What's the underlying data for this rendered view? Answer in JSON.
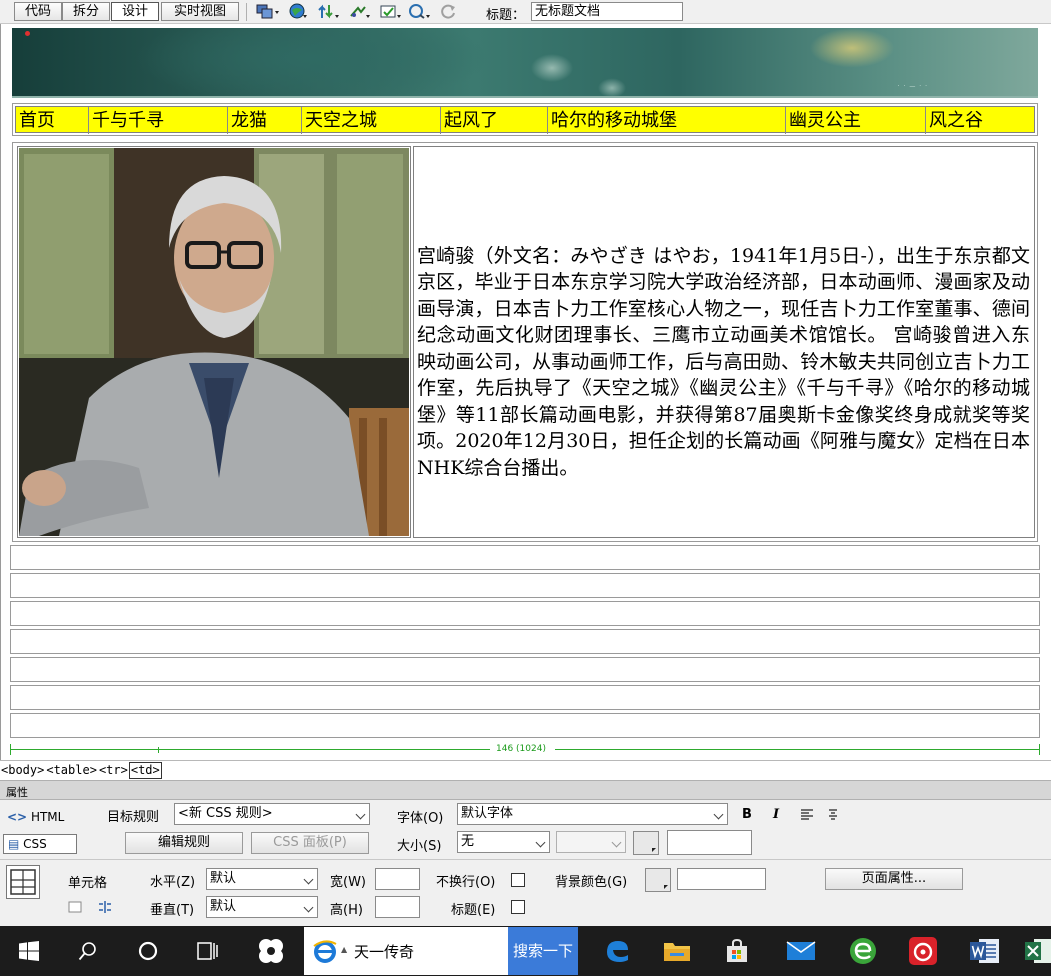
{
  "toolbar": {
    "view_buttons": [
      "代码",
      "拆分",
      "设计",
      "实时视图"
    ],
    "active_view": "设计",
    "icons": [
      "multiscreen-icon",
      "preview-browser-icon",
      "file-management-icon",
      "visual-aids-icon",
      "check-page-icon",
      "validate-icon",
      "refresh-icon"
    ],
    "title_label": "标题：",
    "title_value": "无标题文档"
  },
  "nav": {
    "background": "#ffff00",
    "items": [
      "首页",
      "千与千寻",
      "龙猫",
      "天空之城",
      "起风了",
      "哈尔的移动城堡",
      "幽灵公主",
      "风之谷"
    ]
  },
  "content": {
    "photo_alt": "宫崎骏",
    "bio": "宫崎骏（外文名：みやざき はやお，1941年1月5日-），出生于东京都文京区，毕业于日本东京学习院大学政治经济部，日本动画师、漫画家及动画导演，日本吉卜力工作室核心人物之一，现任吉卜力工作室董事、德间纪念动画文化财团理事长、三鹰市立动画美术馆馆长。 宫崎骏曾进入东映动画公司，从事动画师工作，后与高田勋、铃木敏夫共同创立吉卜力工作室，先后执导了《天空之城》《幽灵公主》《千与千寻》《哈尔的移动城堡》等11部长篇动画电影，并获得第87届奥斯卡金像奖终身成就奖等奖项。2020年12月30日，担任企划的长篇动画《阿雅与魔女》定档在日本NHK综合台播出。"
  },
  "empty_row_count": 7,
  "width_indicator": "146 (1024)",
  "tag_selector": [
    "<body>",
    "<table>",
    "<tr>",
    "<td>"
  ],
  "properties": {
    "panel_title": "属性",
    "html_mode": "HTML",
    "css_mode": "CSS",
    "target_rule_label": "目标规则",
    "target_rule_value": "<新 CSS 规则>",
    "edit_rule_button": "编辑规则",
    "css_panel_button": "CSS 面板(P)",
    "font_label": "字体(O)",
    "font_value": "默认字体",
    "size_label": "大小(S)",
    "size_value": "无",
    "bold": "B",
    "italic": "I",
    "cell_label": "单元格",
    "horz_label": "水平(Z)",
    "horz_value": "默认",
    "vert_label": "垂直(T)",
    "vert_value": "默认",
    "width_label": "宽(W)",
    "height_label": "高(H)",
    "nowrap_label": "不换行(O)",
    "header_label": "标题(E)",
    "bgcolor_label": "背景颜色(G)",
    "page_props_button": "页面属性..."
  },
  "taskbar": {
    "search_value": "天一传奇",
    "search_button": "搜索一下"
  }
}
